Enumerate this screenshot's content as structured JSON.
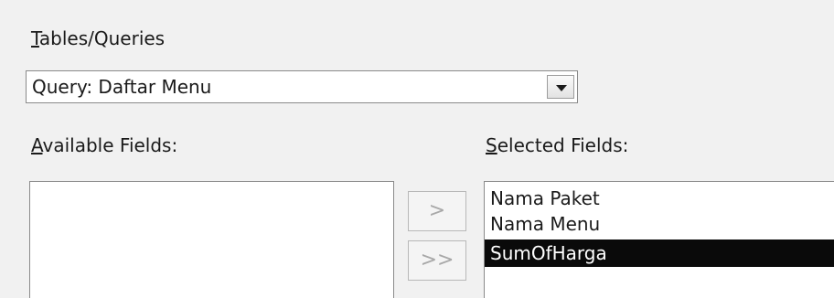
{
  "tables_queries": {
    "label_accel": "T",
    "label_rest": "ables/Queries",
    "selected_value": "Query: Daftar Menu",
    "dropdown_icon": "chevron-down-icon"
  },
  "available_fields": {
    "label_accel": "A",
    "label_rest": "vailable Fields:",
    "items": []
  },
  "move_buttons": {
    "add_one": ">",
    "add_all": ">>"
  },
  "selected_fields": {
    "label_accel": "S",
    "label_rest": "elected Fields:",
    "items": [
      "Nama Paket",
      "Nama Menu",
      "SumOfHarga"
    ],
    "highlighted_item": "SumOfHarga"
  }
}
